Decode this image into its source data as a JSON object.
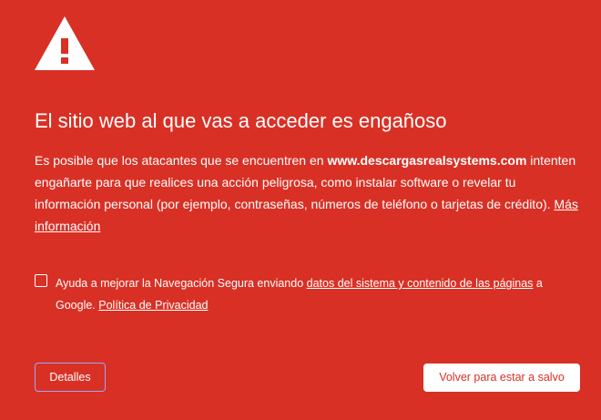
{
  "icon": "warning-triangle-icon",
  "colors": {
    "background": "#d93025",
    "text": "#ffffff",
    "primary_button_text": "#d93025",
    "details_button_border": "#9aa7f5"
  },
  "headline": "El sitio web al que vas a acceder es engañoso",
  "body": {
    "text_before": "Es posible que los atacantes que se encuentren en ",
    "domain": "www.descargasrealsystems.com",
    "text_after": " intenten engañarte para que realices una acción peligrosa, como instalar software o revelar tu información personal (por ejemplo, contraseñas, números de teléfono o tarjetas de crédito). ",
    "more_info_link": "Más información"
  },
  "optin": {
    "checked": false,
    "text_before": "Ayuda a mejorar la Navegación Segura enviando ",
    "data_link": "datos del sistema y contenido de las páginas",
    "text_middle": " a Google. ",
    "privacy_link": "Política de Privacidad"
  },
  "buttons": {
    "details": "Detalles",
    "back_to_safety": "Volver para estar a salvo"
  }
}
